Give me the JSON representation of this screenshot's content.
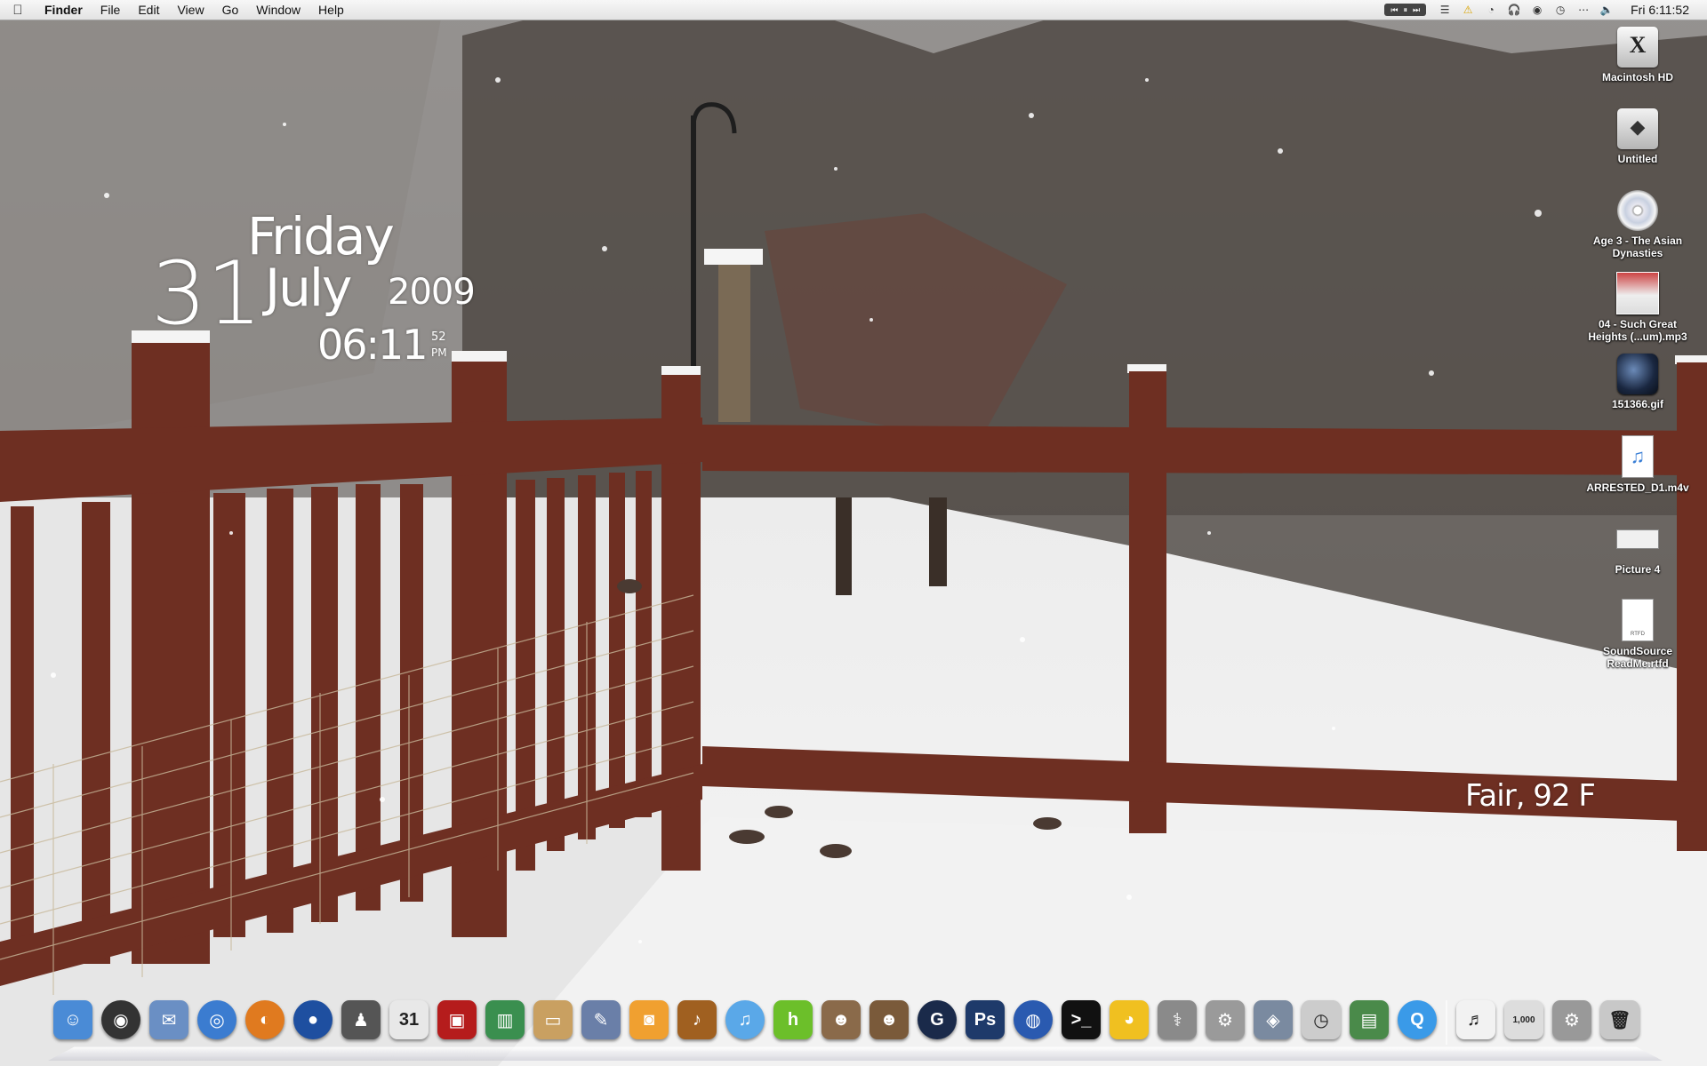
{
  "menubar": {
    "apple_icon": "apple-icon",
    "app_name": "Finder",
    "menus": [
      "File",
      "Edit",
      "View",
      "Go",
      "Window",
      "Help"
    ],
    "clock": "Fri 6:11:52"
  },
  "widget": {
    "day_number": "31",
    "day_name": "Friday",
    "month": "July",
    "year": "2009",
    "time": "06:11",
    "seconds": "52",
    "ampm": "PM",
    "weather": "Fair, 92 F"
  },
  "desktop_icons": [
    {
      "label": "Macintosh HD",
      "icon": "hard-drive-icon"
    },
    {
      "label": "Untitled",
      "icon": "volume-icon"
    },
    {
      "label": "Age 3 - The Asian Dynasties",
      "icon": "cd-icon"
    },
    {
      "label": "04 - Such Great Heights (...um).mp3",
      "icon": "album-art-icon"
    },
    {
      "label": "151366.gif",
      "icon": "image-file-icon"
    },
    {
      "label": "ARRESTED_D1.m4v",
      "icon": "mpeg4-file-icon"
    },
    {
      "label": "Picture 4",
      "icon": "screenshot-file-icon"
    },
    {
      "label": "SoundSource ReadMe.rtfd",
      "icon": "rtfd-file-icon"
    }
  ],
  "dock": [
    {
      "name": "finder",
      "color": "#4a8bd6",
      "glyph": "☺"
    },
    {
      "name": "dashboard",
      "color": "#333333",
      "glyph": "◉"
    },
    {
      "name": "mail",
      "color": "#6a8fc4",
      "glyph": "✉"
    },
    {
      "name": "safari",
      "color": "#3b7cd0",
      "glyph": "◎"
    },
    {
      "name": "firefox",
      "color": "#e07a1f",
      "glyph": "◐"
    },
    {
      "name": "network-globe",
      "color": "#1e4fa0",
      "glyph": "●"
    },
    {
      "name": "silhouette",
      "color": "#555555",
      "glyph": "♟"
    },
    {
      "name": "ical",
      "color": "#e8e8e8",
      "glyph": "31"
    },
    {
      "name": "photo-booth",
      "color": "#b51c1c",
      "glyph": "▣"
    },
    {
      "name": "numbers",
      "color": "#3a8f4f",
      "glyph": "▥"
    },
    {
      "name": "keynote",
      "color": "#c9a061",
      "glyph": "▭"
    },
    {
      "name": "preview",
      "color": "#6a7fa8",
      "glyph": "✎"
    },
    {
      "name": "iphoto",
      "color": "#f0a030",
      "glyph": "◙"
    },
    {
      "name": "garageband",
      "color": "#a06020",
      "glyph": "♪"
    },
    {
      "name": "itunes",
      "color": "#5aa8e8",
      "glyph": "♫"
    },
    {
      "name": "hulu",
      "color": "#6cbf2a",
      "glyph": "h"
    },
    {
      "name": "contacts-a",
      "color": "#8a6a4a",
      "glyph": "☻"
    },
    {
      "name": "contacts-b",
      "color": "#7a5a3a",
      "glyph": "☻"
    },
    {
      "name": "g-app",
      "color": "#1a2a4a",
      "glyph": "G"
    },
    {
      "name": "photoshop",
      "color": "#1e3a6a",
      "glyph": "Ps"
    },
    {
      "name": "google-earth",
      "color": "#2a5ab0",
      "glyph": "◍"
    },
    {
      "name": "terminal",
      "color": "#111111",
      "glyph": ">_"
    },
    {
      "name": "cyberduck",
      "color": "#f0c020",
      "glyph": "◕"
    },
    {
      "name": "disk-utility",
      "color": "#8a8a8a",
      "glyph": "⚕"
    },
    {
      "name": "system-preferences",
      "color": "#9a9a9a",
      "glyph": "⚙"
    },
    {
      "name": "image-viewer",
      "color": "#7a8aa0",
      "glyph": "◈"
    },
    {
      "name": "time-machine",
      "color": "#cccccc",
      "glyph": "◷"
    },
    {
      "name": "screen-sharing",
      "color": "#4a8a4a",
      "glyph": "▤"
    },
    {
      "name": "quicktime",
      "color": "#3a9ae8",
      "glyph": "Q"
    },
    {
      "name": "sep",
      "color": "",
      "glyph": ""
    },
    {
      "name": "midi-document",
      "color": "#f2f2f2",
      "glyph": "♬"
    },
    {
      "name": "counter-doc",
      "color": "#dddddd",
      "glyph": "1,000"
    },
    {
      "name": "prefs-stack",
      "color": "#999999",
      "glyph": "⚙"
    },
    {
      "name": "trash",
      "color": "#c8c8c8",
      "glyph": "🗑"
    }
  ]
}
